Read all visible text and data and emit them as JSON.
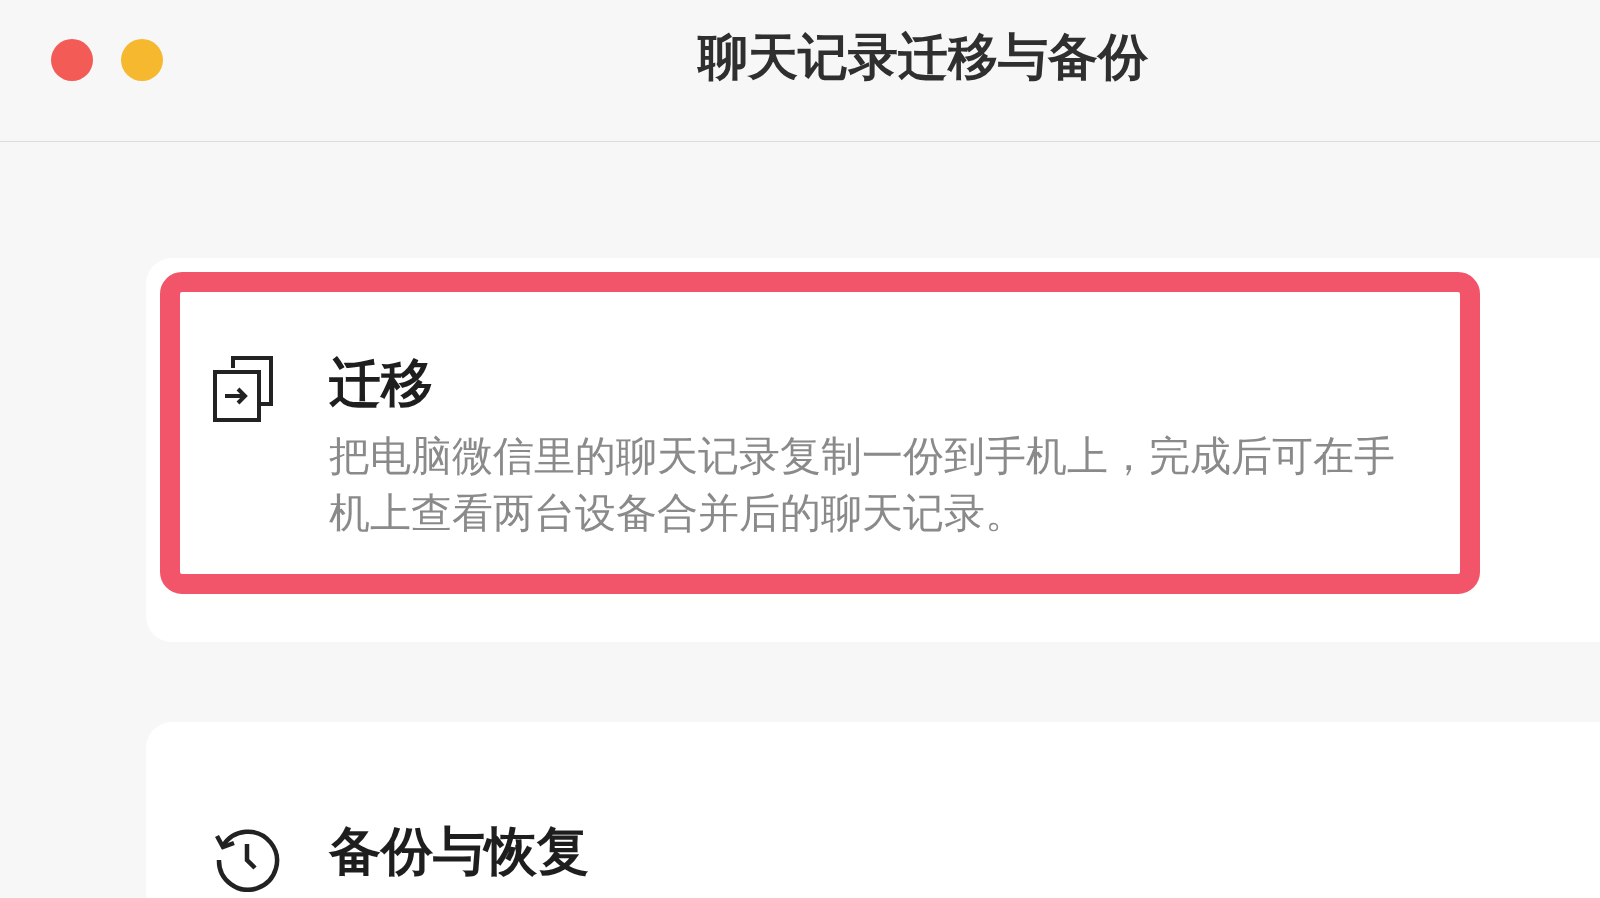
{
  "window": {
    "title": "聊天记录迁移与备份"
  },
  "sections": [
    {
      "kind": "migrate",
      "title": "迁移",
      "description": "把电脑微信里的聊天记录复制一份到手机上，完成后可在手机上查看两台设备合并后的聊天记录。",
      "highlighted": true
    },
    {
      "kind": "backup",
      "title": "备份与恢复",
      "highlighted": false
    }
  ]
}
